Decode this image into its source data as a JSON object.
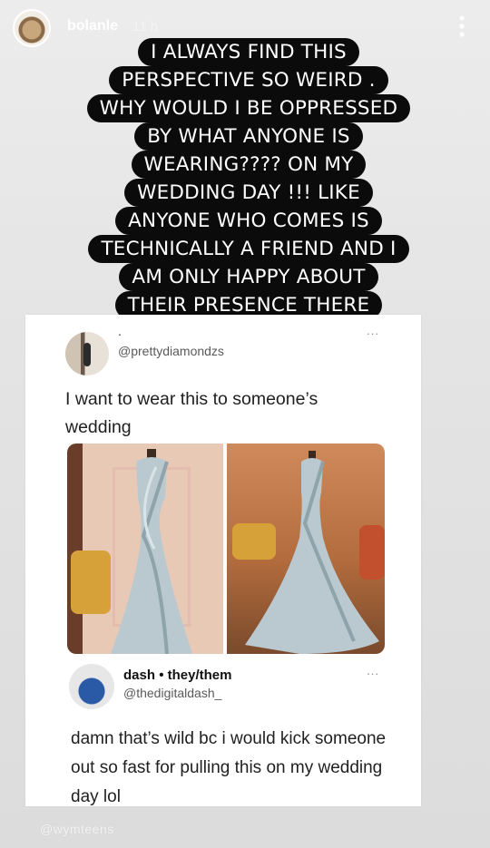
{
  "story": {
    "username": "bolanle",
    "timestamp": "11 h",
    "caption_lines": [
      "I ALWAYS FIND THIS",
      "PERSPECTIVE SO WEIRD .",
      "WHY WOULD I BE OPPRESSED",
      "BY WHAT ANYONE IS",
      "WEARING???? ON MY",
      "WEDDING DAY !!! LIKE",
      "ANYONE WHO COMES IS",
      "TECHNICALLY A FRIEND AND I",
      "AM ONLY HAPPY ABOUT",
      "THEIR PRESENCE THERE"
    ]
  },
  "tweet": {
    "dot": ".",
    "handle": "@prettydiamondzs",
    "text": "I want to wear this to someone’s wedding",
    "ellipsis": "..."
  },
  "reply": {
    "name": "dash",
    "separator": "•",
    "pronouns": "they/them",
    "handle": "@thedigitaldash_",
    "text": "damn that’s wild bc i would kick someone out so fast for pulling this on my wedding day lol",
    "ellipsis": "..."
  },
  "watermark": "@wymteens",
  "colors": {
    "caption_bg": "#0b0b0b",
    "caption_text": "#ffffff",
    "card_bg": "#ffffff",
    "dress": "#b9c9cf"
  }
}
